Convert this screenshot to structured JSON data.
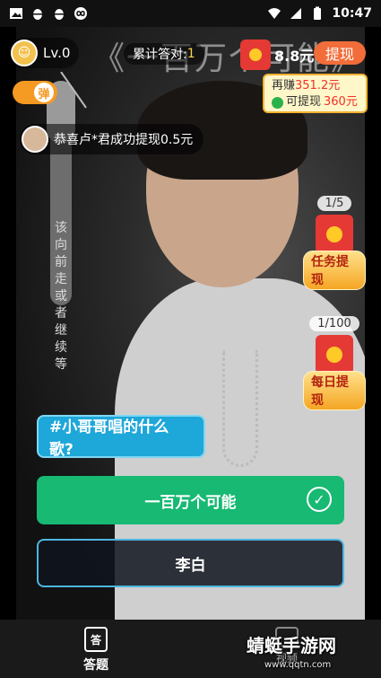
{
  "status_bar": {
    "time": "10:47"
  },
  "video": {
    "title_overlay": "《一百万个可能》",
    "lyrics": [
      "该",
      "向",
      "前",
      "走",
      "或",
      "者",
      "继",
      "续",
      "等"
    ]
  },
  "header": {
    "level": "Lv.0",
    "answered_label": "累计答对:",
    "answered_count": "1",
    "balance": "8.8元",
    "withdraw_label": "提现",
    "earn_more_prefix": "再赚",
    "earn_more_amount": "351.2元",
    "can_withdraw_prefix": "可提现",
    "can_withdraw_amount": "360元",
    "danmu_label": "弹"
  },
  "notice": {
    "text": "恭喜卢*君成功提现0.5元"
  },
  "side": {
    "task": {
      "progress": "1/5",
      "label": "任务提现"
    },
    "daily": {
      "progress": "1/100",
      "label": "每日提现"
    }
  },
  "quiz": {
    "question": "#小哥哥唱的什么歌?",
    "options": [
      {
        "text": "一百万个可能",
        "state": "correct"
      },
      {
        "text": "李白",
        "state": "normal"
      }
    ]
  },
  "bottom_nav": {
    "answer_icon": "答",
    "answer_label": "答题",
    "video_label": "视频"
  },
  "watermark": {
    "title": "蜻蜓手游网",
    "url": "www.qqtn.com"
  },
  "colors": {
    "correct": "#17b973",
    "accent": "#f26d3a",
    "question": "#1ea7d9"
  }
}
